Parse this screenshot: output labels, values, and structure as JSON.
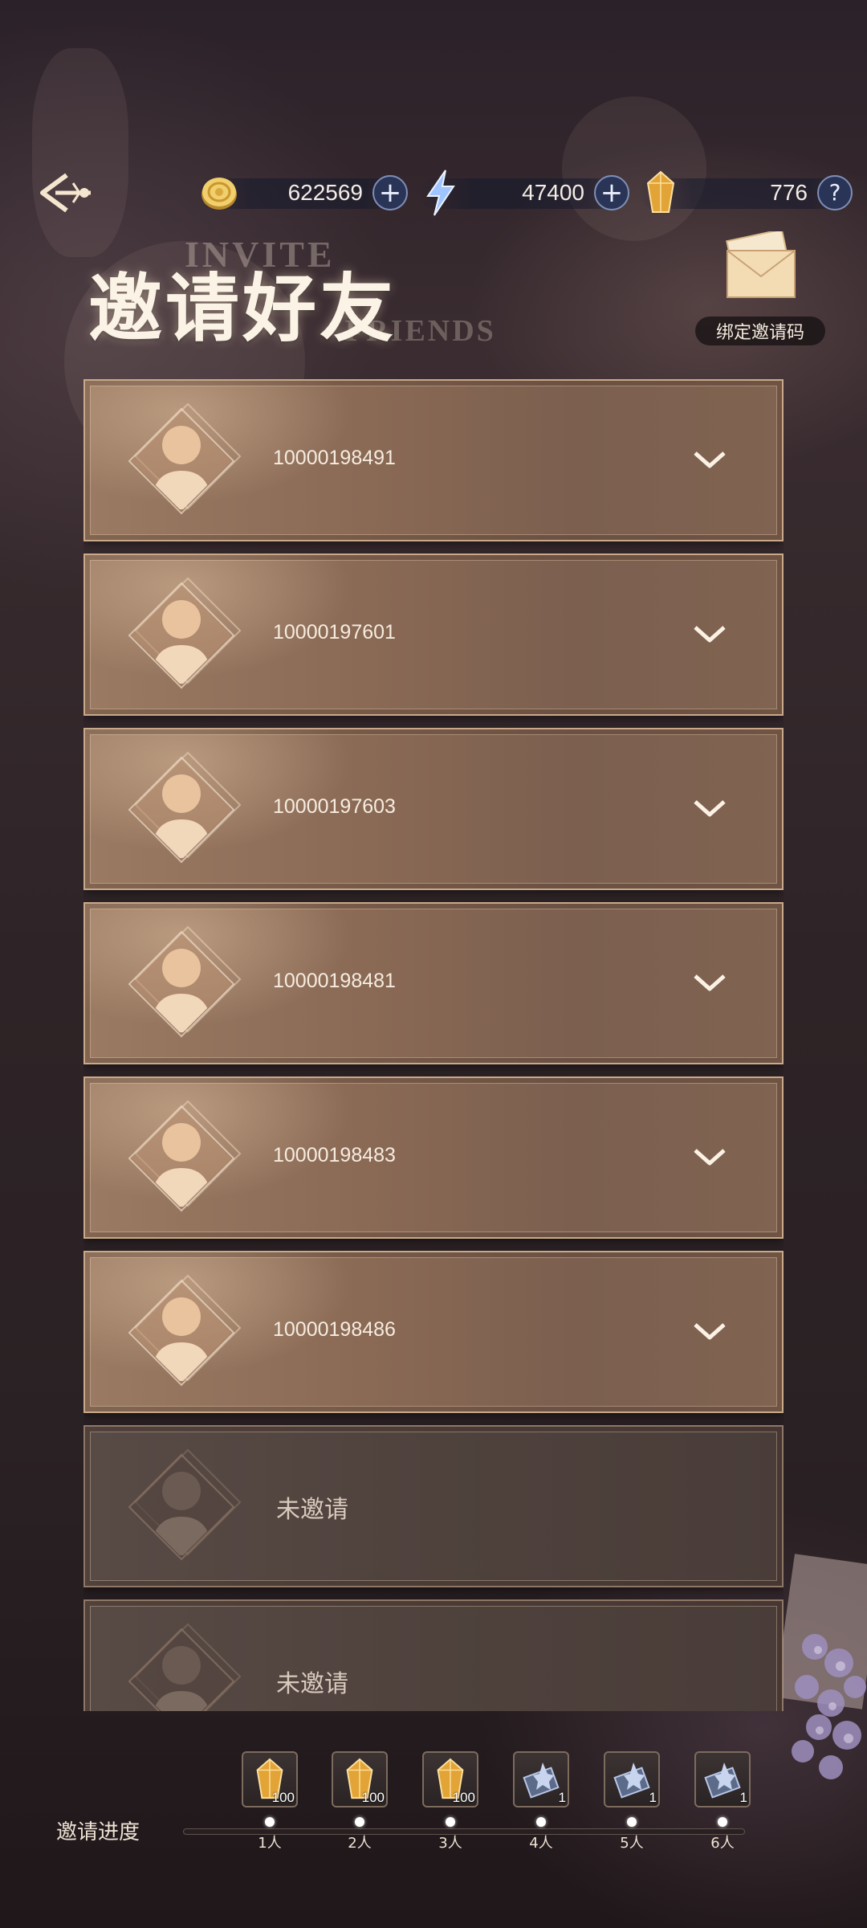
{
  "header": {
    "back_icon": "back-arrow-icon",
    "currencies": [
      {
        "name": "gold-coin",
        "icon": "gold-coin-icon",
        "value": "622569"
      },
      {
        "name": "energy",
        "icon": "lightning-icon",
        "value": "47400"
      },
      {
        "name": "crystal",
        "icon": "amber-crystal-icon",
        "value": "776"
      }
    ],
    "help_label": "?"
  },
  "title": {
    "cn": "邀请好友",
    "en_top": "INVITE",
    "en_bottom": "FRIENDS"
  },
  "bind_invite_code": {
    "label": "绑定邀请码",
    "icon": "envelope-icon"
  },
  "friends": [
    {
      "uid": "10000198491",
      "status": "invited"
    },
    {
      "uid": "10000197601",
      "status": "invited"
    },
    {
      "uid": "10000197603",
      "status": "invited"
    },
    {
      "uid": "10000198481",
      "status": "invited"
    },
    {
      "uid": "10000198483",
      "status": "invited"
    },
    {
      "uid": "10000198486",
      "status": "invited"
    },
    {
      "uid": "未邀请",
      "status": "not-invited"
    },
    {
      "uid": "未邀请",
      "status": "not-invited"
    }
  ],
  "progress": {
    "label": "邀请进度",
    "steps": [
      {
        "count": "1人",
        "reward": "amber-crystal-icon",
        "qty": "100"
      },
      {
        "count": "2人",
        "reward": "amber-crystal-icon",
        "qty": "100"
      },
      {
        "count": "3人",
        "reward": "amber-crystal-icon",
        "qty": "100"
      },
      {
        "count": "4人",
        "reward": "ticket-icon",
        "qty": "1"
      },
      {
        "count": "5人",
        "reward": "ticket-icon",
        "qty": "1"
      },
      {
        "count": "6人",
        "reward": "ticket-icon",
        "qty": "1"
      }
    ]
  },
  "colors": {
    "card_border": "#c9a98a",
    "card_fill": "#8a6a55",
    "empty_card_fill": "#4f423d",
    "plus_button": "#2a3456"
  }
}
